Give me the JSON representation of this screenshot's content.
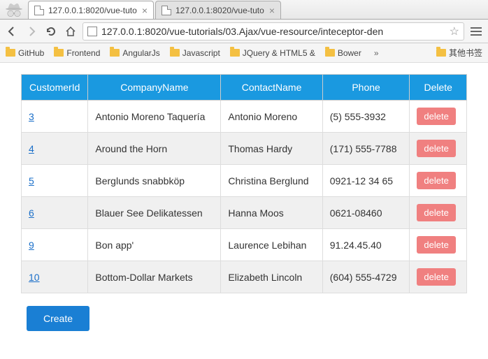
{
  "tabs": [
    {
      "title": "127.0.0.1:8020/vue-tuto"
    },
    {
      "title": "127.0.0.1:8020/vue-tuto"
    }
  ],
  "url": "127.0.0.1:8020/vue-tutorials/03.Ajax/vue-resource/inteceptor-den",
  "bookmarks": {
    "b0": "GitHub",
    "b1": "Frontend",
    "b2": "AngularJs",
    "b3": "Javascript",
    "b4": "JQuery & HTML5 &",
    "b5": "Bower",
    "overflow": "»",
    "b_right": "其他书签"
  },
  "table": {
    "headers": {
      "h0": "CustomerId",
      "h1": "CompanyName",
      "h2": "ContactName",
      "h3": "Phone",
      "h4": "Delete"
    },
    "rows": [
      {
        "id": "3",
        "company": "Antonio Moreno Taquería",
        "contact": "Antonio Moreno",
        "phone": "(5) 555-3932"
      },
      {
        "id": "4",
        "company": "Around the Horn",
        "contact": "Thomas Hardy",
        "phone": "(171) 555-7788"
      },
      {
        "id": "5",
        "company": "Berglunds snabbköp",
        "contact": "Christina Berglund",
        "phone": "0921-12 34 65"
      },
      {
        "id": "6",
        "company": "Blauer See Delikatessen",
        "contact": "Hanna Moos",
        "phone": "0621-08460"
      },
      {
        "id": "9",
        "company": "Bon app'",
        "contact": "Laurence Lebihan",
        "phone": "91.24.45.40"
      },
      {
        "id": "10",
        "company": "Bottom-Dollar Markets",
        "contact": "Elizabeth Lincoln",
        "phone": "(604) 555-4729"
      }
    ],
    "delete_label": "delete"
  },
  "create_label": "Create"
}
